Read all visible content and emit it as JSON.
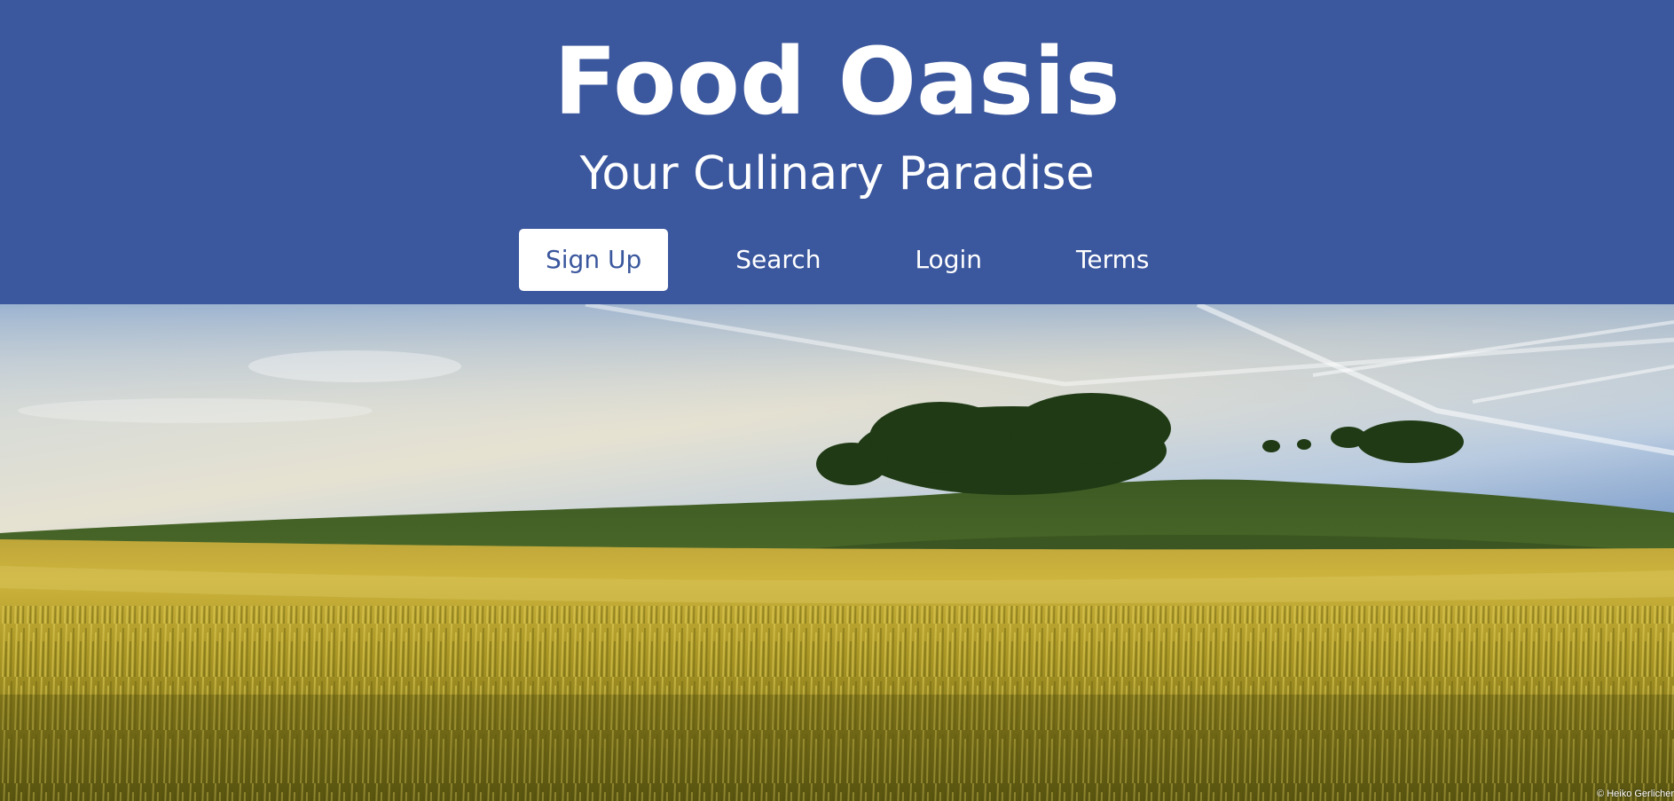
{
  "header": {
    "title": "Food Oasis",
    "tagline": "Your Culinary Paradise",
    "background_color": "#3b579d",
    "text_color": "#ffffff"
  },
  "nav": {
    "items": [
      {
        "label": "Sign Up",
        "active": true
      },
      {
        "label": "Search",
        "active": false
      },
      {
        "label": "Login",
        "active": false
      },
      {
        "label": "Terms",
        "active": false
      }
    ],
    "active_bg_color": "#ffffff",
    "active_text_color": "#3b579d"
  },
  "hero": {
    "photo_credit": "© Heiko Gerlicher"
  }
}
